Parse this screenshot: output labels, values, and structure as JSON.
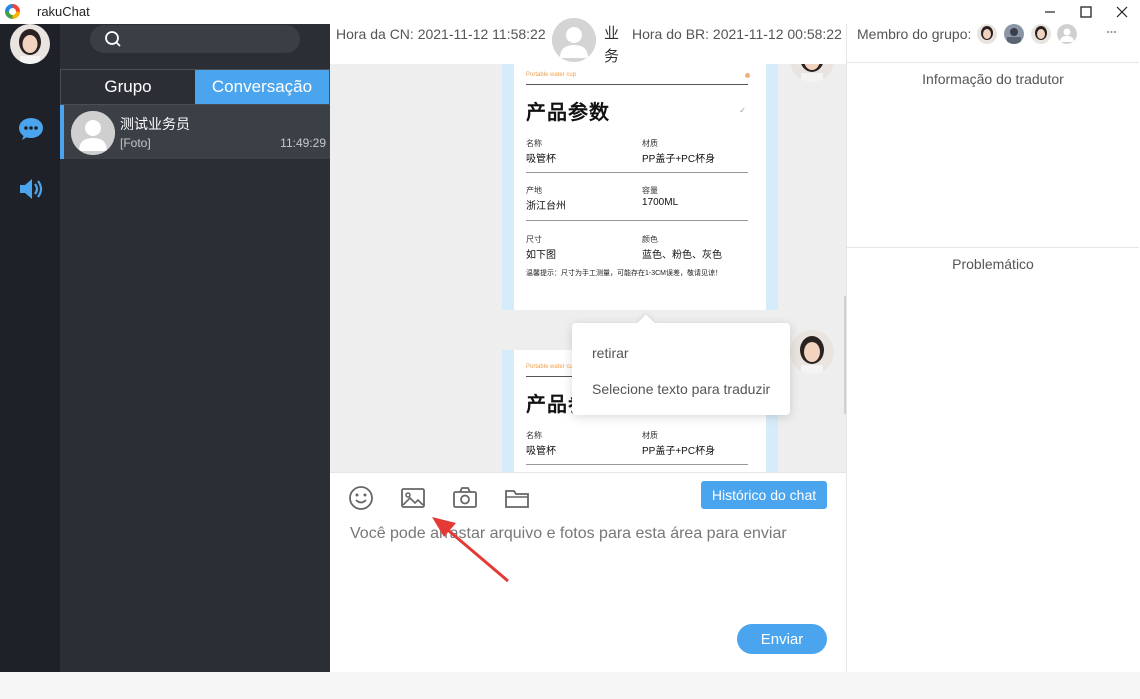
{
  "window": {
    "title": "rakuChat"
  },
  "search": {
    "placeholder": ""
  },
  "tabs": [
    {
      "label": "Grupo"
    },
    {
      "label": "Conversação"
    }
  ],
  "conversation": {
    "name": "测试业务员",
    "preview": "[Foto]",
    "time": "11:49:29"
  },
  "header": {
    "cn_time": "Hora da CN: 2021-11-12 11:58:22",
    "br_time": "Hora do BR: 2021-11-12 00:58:22",
    "contact_name": "业务"
  },
  "product_card": {
    "brand": "Portable water cup",
    "title": "产品参数",
    "rows": [
      {
        "l1": "名称",
        "v1": "吸管杯",
        "l2": "材质",
        "v2": "PP盖子+PC杯身"
      },
      {
        "l1": "产地",
        "v1": "浙江台州",
        "l2": "容量",
        "v2": "1700ML"
      },
      {
        "l1": "尺寸",
        "v1": "如下图",
        "l2": "颜色",
        "v2": "蓝色、粉色、灰色"
      }
    ],
    "note": "温馨提示：尺寸为手工测量，可能存在1-3CM误差，敬请见谅！"
  },
  "context_menu": {
    "items": [
      "retirar",
      "Selecione texto para traduzir"
    ]
  },
  "composer": {
    "history_button": "Histórico do chat",
    "placeholder": "Você pode arrastar arquivo e fotos para esta área para enviar",
    "send_button": "Enviar"
  },
  "right_panel": {
    "members_label": "Membro do grupo:",
    "translator_title": "Informação do tradutor",
    "problem_title": "Problemático"
  },
  "colors": {
    "accent": "#4aa5ee",
    "rail": "#1e2228",
    "list": "#2b2f35",
    "annotation_arrow": "#e53935"
  }
}
